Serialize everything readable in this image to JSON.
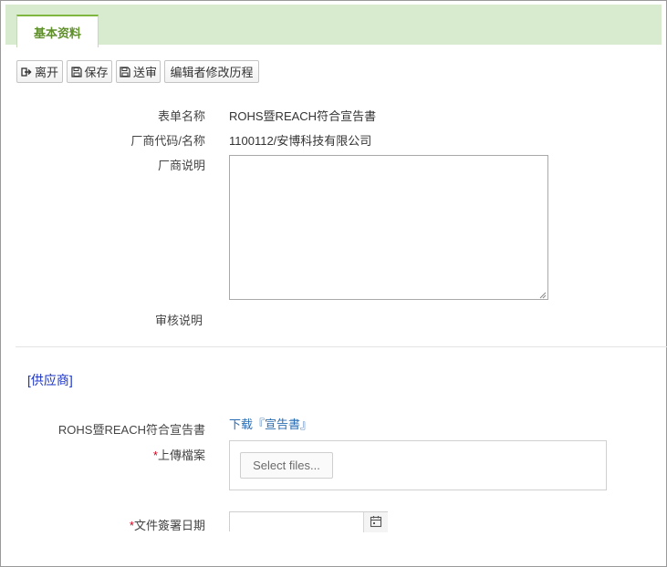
{
  "tabs": [
    {
      "label": "基本资料",
      "active": true
    }
  ],
  "toolbar": {
    "leave": {
      "label": "离开",
      "icon": "exit-icon"
    },
    "save": {
      "label": "保存",
      "icon": "floppy-disk-icon"
    },
    "submit": {
      "label": "送审",
      "icon": "floppy-disk-icon"
    },
    "history": {
      "label": "编辑者修改历程"
    }
  },
  "form": {
    "form_name_label": "表单名称",
    "form_name_value": "ROHS暨REACH符合宣告書",
    "vendor_label": "厂商代码/名称",
    "vendor_value": "1100112/安博科技有限公司",
    "vendor_note_label": "厂商说明",
    "vendor_note_value": "",
    "review_note_label": "审核说明"
  },
  "supplier": {
    "section_title": "[供应商]",
    "declaration_label": "ROHS暨REACH符合宣告書",
    "download_link": "下载『宣告書』",
    "required_mark": "*",
    "upload_label": "上傳檔案",
    "select_files": "Select files...",
    "sign_date_label": "文件簽署日期",
    "sign_date_value": ""
  },
  "colors": {
    "tab_bar": "#d9ebcf",
    "tab_text": "#5f8f2b",
    "section_title": "#1a33c6",
    "link": "#2a6cb3",
    "required": "#d0021b"
  }
}
